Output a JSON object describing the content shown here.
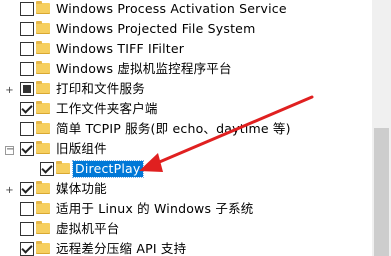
{
  "tree": {
    "items": [
      {
        "label": "Windows Process Activation Service",
        "checked": "none",
        "expander": ""
      },
      {
        "label": "Windows Projected File System",
        "checked": "none",
        "expander": ""
      },
      {
        "label": "Windows TIFF IFilter",
        "checked": "none",
        "expander": ""
      },
      {
        "label": "Windows 虚拟机监控程序平台",
        "checked": "none",
        "expander": ""
      },
      {
        "label": "打印和文件服务",
        "checked": "partial",
        "expander": "+"
      },
      {
        "label": "工作文件夹客户端",
        "checked": "checked",
        "expander": ""
      },
      {
        "label": "简单 TCPIP 服务(即 echo、daytime 等)",
        "checked": "none",
        "expander": ""
      },
      {
        "label": "旧版组件",
        "checked": "checked",
        "expander": "−"
      },
      {
        "label": "DirectPlay",
        "checked": "checked",
        "expander": "",
        "selected": true
      },
      {
        "label": "媒体功能",
        "checked": "checked",
        "expander": "+"
      },
      {
        "label": "适用于 Linux 的 Windows 子系统",
        "checked": "none",
        "expander": ""
      },
      {
        "label": "虚拟机平台",
        "checked": "none",
        "expander": ""
      },
      {
        "label": "远程差分压缩 API 支持",
        "checked": "checked",
        "expander": ""
      }
    ]
  },
  "annotation": {
    "arrow_color": "#e02020"
  },
  "colors": {
    "selection": "#0078d7",
    "folder": "#f6cf5f"
  }
}
